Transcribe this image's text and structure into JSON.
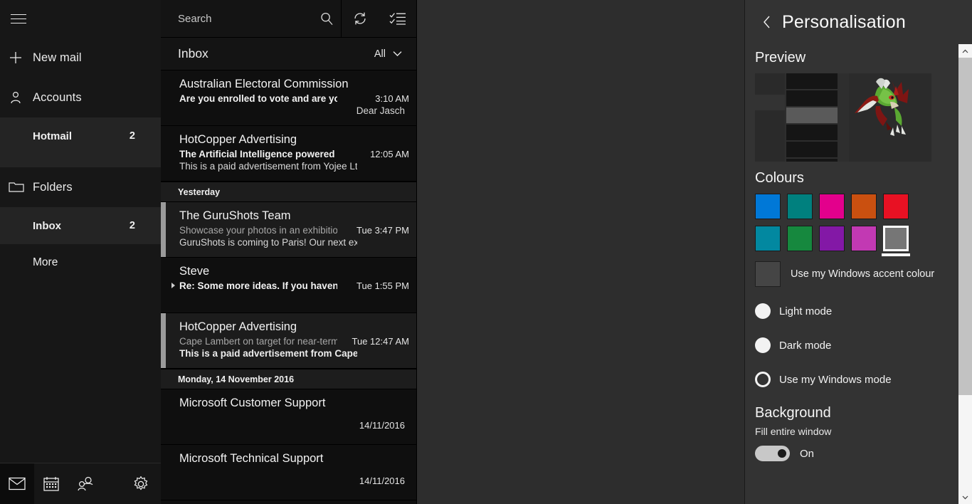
{
  "sidebar": {
    "menu_icon": "hamburger-icon",
    "new_mail": {
      "label": "New mail",
      "icon": "plus-icon"
    },
    "accounts": {
      "label": "Accounts",
      "icon": "person-icon"
    },
    "account_items": [
      {
        "label": "Hotmail",
        "count": "2"
      }
    ],
    "folders": {
      "label": "Folders",
      "icon": "folder-icon"
    },
    "folder_items": [
      {
        "label": "Inbox",
        "count": "2"
      },
      {
        "label": "More",
        "count": ""
      }
    ],
    "bottom_tools": [
      {
        "name": "mail-icon",
        "label": "Mail"
      },
      {
        "name": "calendar-icon",
        "label": "Calendar"
      },
      {
        "name": "people-icon",
        "label": "People"
      },
      {
        "name": "settings-gear-icon",
        "label": "Settings"
      }
    ]
  },
  "message_list": {
    "search": {
      "placeholder": "Search",
      "icon": "search-icon"
    },
    "sync_icon": "sync-icon",
    "select_icon": "select-mode-icon",
    "header": {
      "title": "Inbox",
      "filter": "All",
      "chevron": "chevron-down-icon"
    },
    "groups": [
      {
        "label": "",
        "messages": [
          {
            "from": "Australian Electoral Commission",
            "subject": "Are you enrolled to vote and are your details",
            "time": "3:10 AM",
            "preview": "Dear Jasch",
            "preview_align": "right",
            "unread": true,
            "selected": false,
            "accent": false,
            "expander": false
          },
          {
            "from": "HotCopper Advertising",
            "subject": "The Artificial Intelligence powered logistics",
            "time": "12:05 AM",
            "preview": "This is a paid advertisement from Yojee Ltd.",
            "preview_align": "left",
            "unread": true,
            "selected": false,
            "accent": false,
            "expander": false
          }
        ]
      },
      {
        "label": "Yesterday",
        "messages": [
          {
            "from": "The GuruShots Team",
            "subject": "Showcase your photos in an exhibition in",
            "time": "Tue 3:47 PM",
            "preview": "GuruShots is coming to Paris! Our next ex",
            "preview_align": "left",
            "unread": false,
            "selected": true,
            "accent": true,
            "expander": false
          },
          {
            "from": "Steve",
            "subject": "Re: Some more ideas. If you haven't alre",
            "time": "Tue 1:55 PM",
            "preview": "",
            "preview_align": "left",
            "unread": true,
            "selected": false,
            "accent": false,
            "expander": true
          },
          {
            "from": "HotCopper Advertising",
            "subject": "Cape Lambert on target for near-term",
            "time": "Tue 12:47 AM",
            "preview": "This is a paid advertisement from Cape L",
            "preview_align": "left",
            "unread": false,
            "selected": true,
            "accent": true,
            "expander": false,
            "preview_bold": true
          }
        ]
      },
      {
        "label": "Monday, 14 November 2016",
        "messages": [
          {
            "from": "Microsoft Customer Support",
            "subject": "",
            "time": "",
            "datestamp": "14/11/2016",
            "preview": "",
            "unread": false,
            "selected": false,
            "accent": false,
            "expander": false
          },
          {
            "from": "Microsoft Technical Support",
            "subject": "",
            "time": "",
            "datestamp": "14/11/2016",
            "preview": "",
            "unread": false,
            "selected": false,
            "accent": false,
            "expander": false
          }
        ]
      }
    ]
  },
  "settings": {
    "back_icon": "chevron-left-icon",
    "title": "Personalisation",
    "preview_title": "Preview",
    "colours_title": "Colours",
    "swatches_row1": [
      "#0078D7",
      "#00807E",
      "#E3008C",
      "#CA5010",
      "#E81123"
    ],
    "swatches_row2": [
      "#0288A0",
      "#16883E",
      "#8318A6",
      "#C239B3",
      "#767676"
    ],
    "selected_swatch_index": 4,
    "selected_swatch_row": 2,
    "accent_option": {
      "label": "Use my Windows accent colour",
      "swatch": "#454545"
    },
    "modes": [
      {
        "label": "Light mode",
        "state": "filled"
      },
      {
        "label": "Dark mode",
        "state": "filled"
      },
      {
        "label": "Use my Windows mode",
        "state": "selected"
      }
    ],
    "background_title": "Background",
    "background_sub": "Fill entire window",
    "background_toggle": {
      "value": "On",
      "on": true
    }
  }
}
